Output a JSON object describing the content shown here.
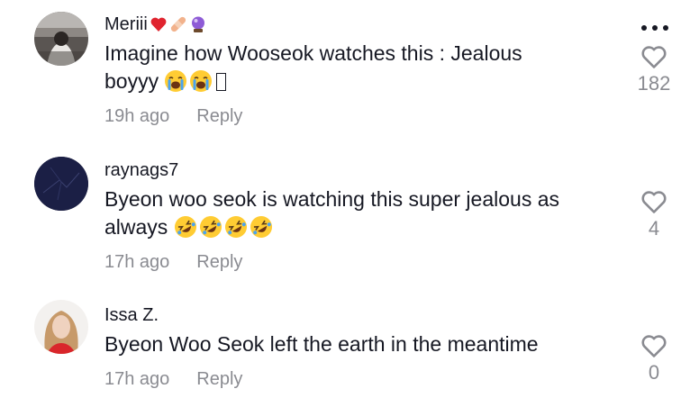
{
  "comments": [
    {
      "username": "Meriii",
      "username_emojis": [
        "red-heart-icon",
        "bandage-icon",
        "crystal-ball-icon"
      ],
      "text_line1": "Imagine how Wooseok watches this : Jealous",
      "text_line2": "boyyy",
      "text_emojis": [
        "loudly-crying-face-icon",
        "loudly-crying-face-icon",
        "missing-glyph-icon"
      ],
      "time": "19h ago",
      "reply_label": "Reply",
      "likes": "182"
    },
    {
      "username": "raynags7",
      "text_line1": "Byeon woo seok is watching this super jealous as",
      "text_line2": "always",
      "text_emojis": [
        "rolling-on-floor-laughing-icon",
        "rolling-on-floor-laughing-icon",
        "rolling-on-floor-laughing-icon",
        "rolling-on-floor-laughing-icon"
      ],
      "time": "17h ago",
      "reply_label": "Reply",
      "likes": "4"
    },
    {
      "username": "Issa Z.",
      "text_line1": "Byeon Woo Seok left the earth in the meantime",
      "time": "17h ago",
      "reply_label": "Reply",
      "likes": "0"
    }
  ],
  "colors": {
    "text": "#161823",
    "muted": "#8a8b91",
    "heart_outline": "#8a8b91"
  }
}
